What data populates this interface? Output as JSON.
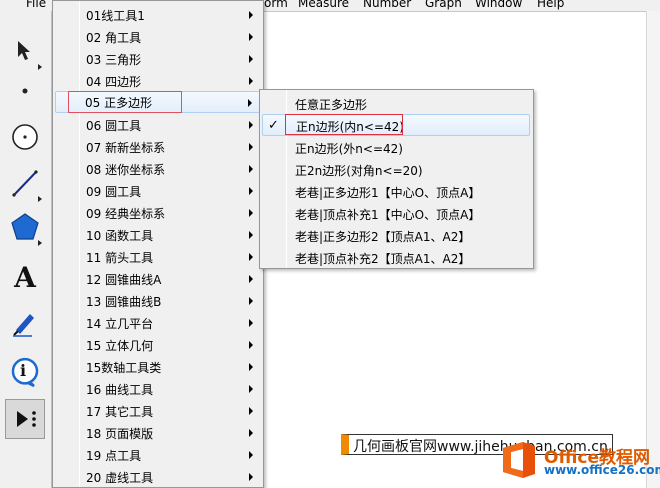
{
  "menubar": {
    "file_partial": "File",
    "items": [
      "orm",
      "Measure",
      "Number",
      "Graph",
      "Window",
      "Help"
    ]
  },
  "toolbar": {
    "tools": [
      "arrow-select-icon",
      "point-icon",
      "compass-circle-icon",
      "line-segment-icon",
      "polygon-icon",
      "text-a-icon",
      "marker-pen-icon",
      "info-icon",
      "custom-tools-icon"
    ],
    "text_glyph": "A",
    "info_glyph": "i"
  },
  "menu": {
    "items": [
      {
        "label": "01线工具1"
      },
      {
        "label": "02 角工具"
      },
      {
        "label": "03 三角形"
      },
      {
        "label": "04 四边形"
      },
      {
        "label": "05 正多边形",
        "highlighted": true
      },
      {
        "label": "06 圆工具"
      },
      {
        "label": "07 新新坐标系"
      },
      {
        "label": "08 迷你坐标系"
      },
      {
        "label": "09 圆工具"
      },
      {
        "label": "09 经典坐标系"
      },
      {
        "label": "10 函数工具"
      },
      {
        "label": "11 箭头工具"
      },
      {
        "label": "12 圆锥曲线A"
      },
      {
        "label": "13 圆锥曲线B"
      },
      {
        "label": "14 立几平台"
      },
      {
        "label": "15 立体几何"
      },
      {
        "label": "15数轴工具类"
      },
      {
        "label": "16 曲线工具"
      },
      {
        "label": "17 其它工具"
      },
      {
        "label": "18 页面模版"
      },
      {
        "label": "19 点工具"
      },
      {
        "label": "20 虚线工具"
      }
    ]
  },
  "submenu": {
    "items": [
      {
        "label": "任意正多边形"
      },
      {
        "label": "正n边形(内n<=42)",
        "checked": true
      },
      {
        "label": "正n边形(外n<=42)"
      },
      {
        "label": "正2n边形(对角n<=20)"
      },
      {
        "label": "老巷|正多边形1【中心O、顶点A】"
      },
      {
        "label": "老巷|顶点补充1【中心O、顶点A】"
      },
      {
        "label": "老巷|正多边形2【顶点A1、A2】"
      },
      {
        "label": "老巷|顶点补充2【顶点A1、A2】"
      }
    ],
    "check_glyph": "✓"
  },
  "watermark": {
    "text": "几何画板官网www.jihehuaban.com.cn",
    "brand": "Office教程网",
    "url": "www.office26.com"
  },
  "colors": {
    "highlight_border": "#e03040",
    "brand_orange": "#e05a00",
    "brand_blue": "#1570c6"
  }
}
